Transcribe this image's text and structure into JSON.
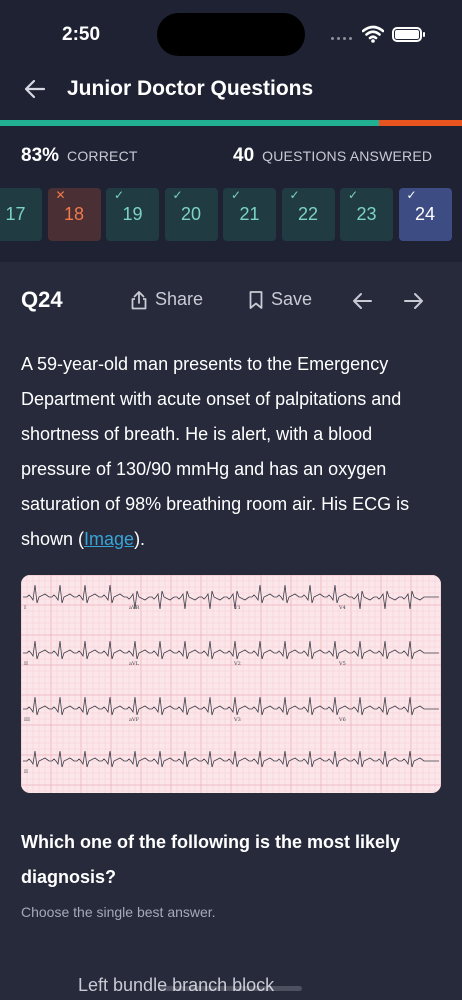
{
  "status_bar": {
    "time": "2:50"
  },
  "header": {
    "title": "Junior Doctor Questions"
  },
  "progress": {
    "fraction": 0.82,
    "fill_color": "#21b092",
    "track_color": "#e8541f"
  },
  "stats": {
    "correct_value": "83%",
    "correct_label": "CORRECT",
    "answered_value": "40",
    "answered_label": "QUESTIONS ANSWERED"
  },
  "question_nav": [
    {
      "number": "17",
      "status": "correct"
    },
    {
      "number": "18",
      "status": "wrong",
      "mark": "✕"
    },
    {
      "number": "19",
      "status": "correct",
      "mark": "✓"
    },
    {
      "number": "20",
      "status": "correct",
      "mark": "✓"
    },
    {
      "number": "21",
      "status": "correct",
      "mark": "✓"
    },
    {
      "number": "22",
      "status": "correct",
      "mark": "✓"
    },
    {
      "number": "23",
      "status": "correct",
      "mark": "✓"
    },
    {
      "number": "24",
      "status": "current",
      "mark": "✓"
    }
  ],
  "toolbar": {
    "question_label": "Q24",
    "share_label": "Share",
    "save_label": "Save"
  },
  "question": {
    "stem_text": "A 59-year-old man presents to the Emergency Department with acute onset of palpitations and shortness of breath. He is alert, with a blood pressure of 130/90 mmHg and has an oxygen saturation of 98% breathing room air. His ECG is shown (",
    "image_link": "Image",
    "stem_end": ").",
    "prompt": "Which one of the following is the most likely diagnosis?",
    "instruction": "Choose the single best answer."
  },
  "ecg_leads": {
    "row1": [
      "I",
      "aVR",
      "V1",
      "V4"
    ],
    "row2": [
      "II",
      "aVL",
      "V2",
      "V5"
    ],
    "row3": [
      "III",
      "aVF",
      "V3",
      "V6"
    ],
    "row4": [
      "II"
    ]
  },
  "options": [
    {
      "label": "Left bundle branch block"
    }
  ]
}
